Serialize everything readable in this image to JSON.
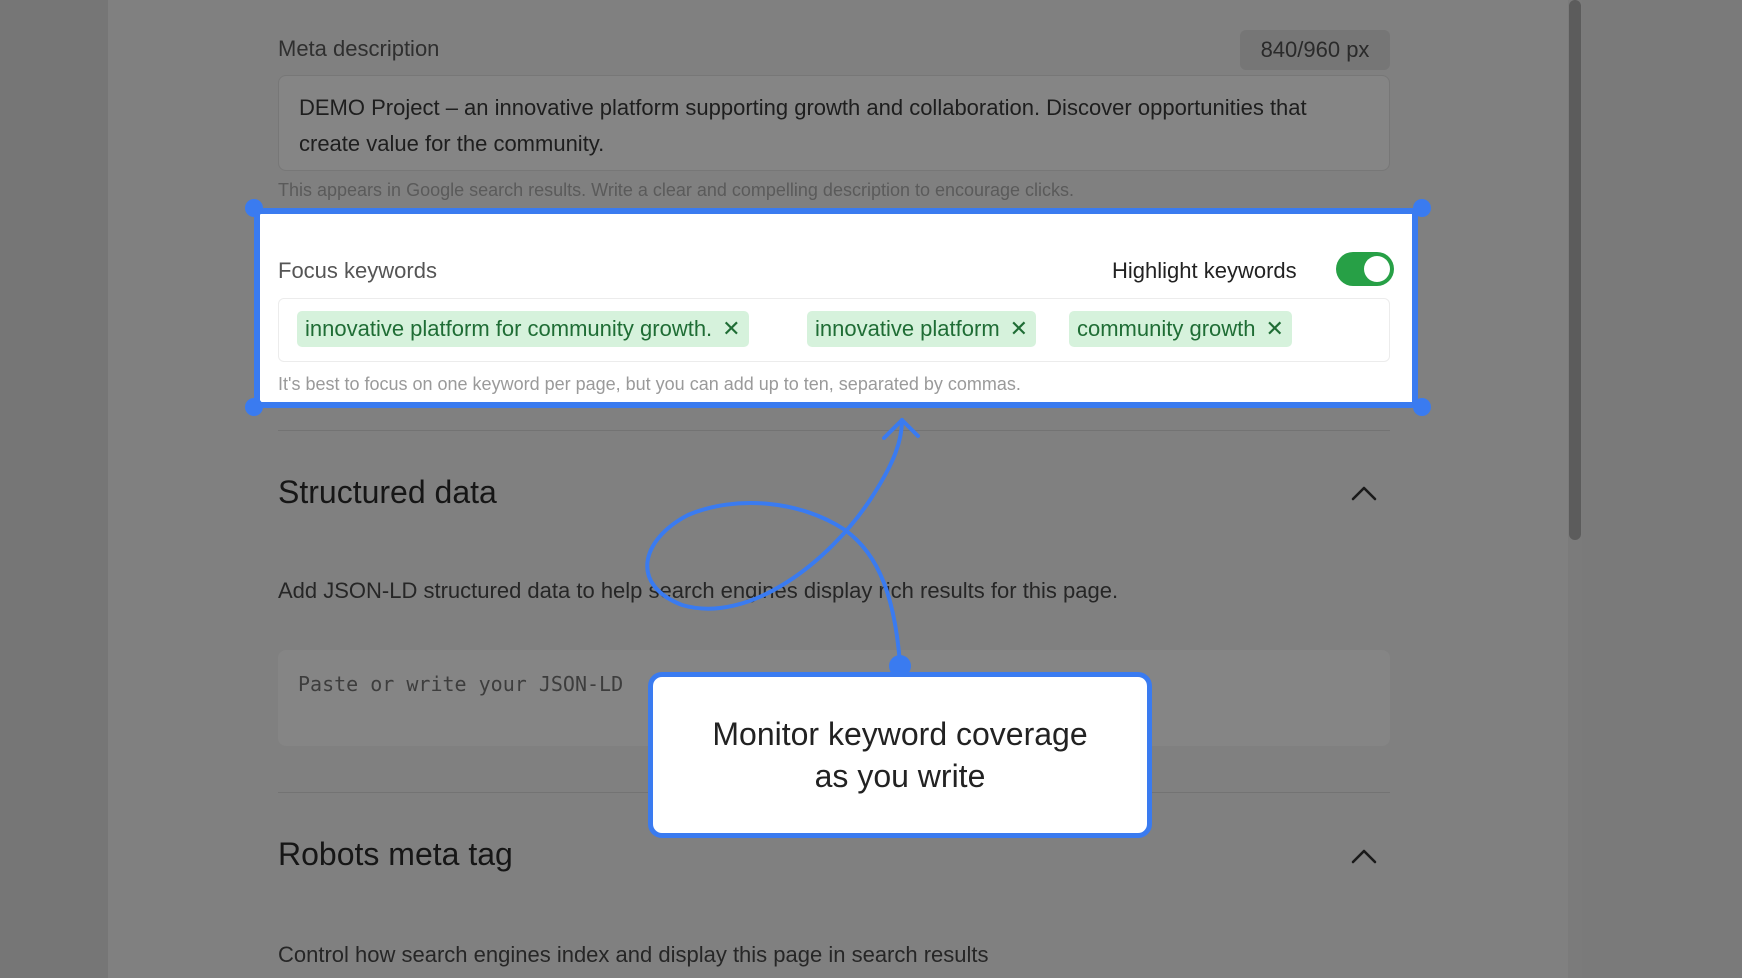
{
  "meta_description": {
    "label": "Meta description",
    "counter": "840/960 px",
    "value": "DEMO Project – an innovative platform supporting growth and collaboration. Discover opportunities that create value for the community.",
    "help": "This appears in Google search results. Write a clear and compelling description to encourage clicks."
  },
  "focus_keywords": {
    "label": "Focus keywords",
    "highlight_label": "Highlight keywords",
    "highlight_on": true,
    "tags": [
      "innovative platform for community growth.",
      "innovative platform",
      "community growth"
    ],
    "help": "It's best to focus on one keyword per page, but you can add up to ten, separated by commas."
  },
  "structured_data": {
    "title": "Structured data",
    "description": "Add JSON-LD structured data to help search engines display rich results for this page.",
    "placeholder": "Paste or write your JSON-LD"
  },
  "robots": {
    "title": "Robots meta tag",
    "description": "Control how search engines index and display this page in search results"
  },
  "callout": {
    "line1": "Monitor keyword coverage",
    "line2": "as you write"
  },
  "colors": {
    "accent": "#3a7bf0",
    "toggle_on": "#27a046",
    "tag_bg": "#d6f2dc",
    "tag_text": "#1f6d35",
    "overlay": "#808080"
  }
}
